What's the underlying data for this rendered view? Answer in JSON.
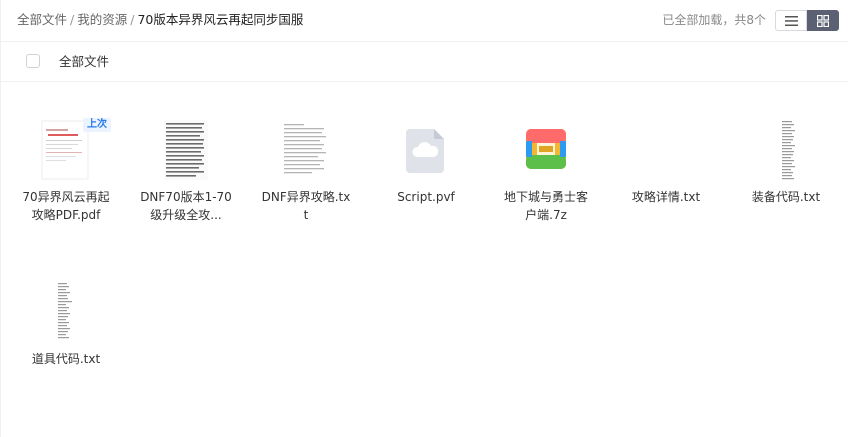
{
  "breadcrumb": {
    "items": [
      "全部文件",
      "我的资源",
      "70版本异界风云再起同步国服"
    ],
    "separator": "/"
  },
  "status_text": "已全部加载，共8个",
  "select_all_label": "全部文件",
  "files": [
    {
      "name": "70异界风云再起攻略PDF.pdf",
      "badge": "上次",
      "thumb": "pdf"
    },
    {
      "name": "DNF70版本1-70级升级全攻...",
      "thumb": "doc"
    },
    {
      "name": "DNF异界攻略.txt",
      "thumb": "doc"
    },
    {
      "name": "Script.pvf",
      "thumb": "cloud"
    },
    {
      "name": "地下城与勇士客户端.7z",
      "thumb": "zip"
    },
    {
      "name": "攻略详情.txt",
      "thumb": "blank"
    },
    {
      "name": "装备代码.txt",
      "thumb": "list"
    },
    {
      "name": "道具代码.txt",
      "thumb": "list"
    }
  ],
  "colors": {
    "toggle_active": "#5b6172",
    "badge_text": "#2b7be6",
    "badge_bg": "#eaf3ff",
    "archive_top": "#ff6b6b",
    "archive_bottom": "#5bbf4a",
    "archive_left": "#2d9cf0"
  },
  "icons": [
    "list-view-icon",
    "grid-view-icon",
    "cloud-icon",
    "archive-icon"
  ]
}
